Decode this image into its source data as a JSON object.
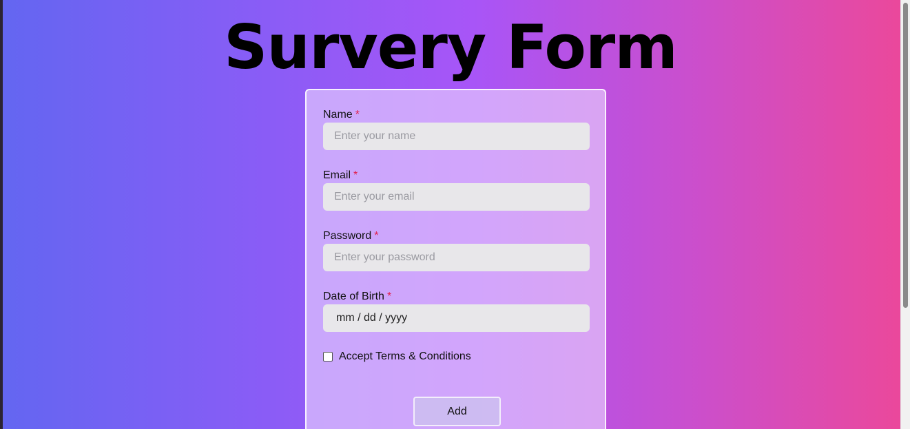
{
  "page": {
    "title": "Survery Form"
  },
  "form": {
    "fields": [
      {
        "label": "Name",
        "required_mark": "*",
        "placeholder": "Enter your name",
        "value": ""
      },
      {
        "label": "Email",
        "required_mark": "*",
        "placeholder": "Enter your email",
        "value": ""
      },
      {
        "label": "Password",
        "required_mark": "*",
        "placeholder": "Enter your password",
        "value": ""
      },
      {
        "label": "Date of Birth",
        "required_mark": "*",
        "placeholder": "mm / dd / yyyy",
        "value": ""
      }
    ],
    "checkbox": {
      "label": "Accept Terms & Conditions",
      "checked": false
    },
    "submit_label": "Add"
  },
  "colors": {
    "gradient_start": "#6366f1",
    "gradient_mid": "#a855f7",
    "gradient_end": "#ec4899",
    "required": "#e11d48"
  }
}
